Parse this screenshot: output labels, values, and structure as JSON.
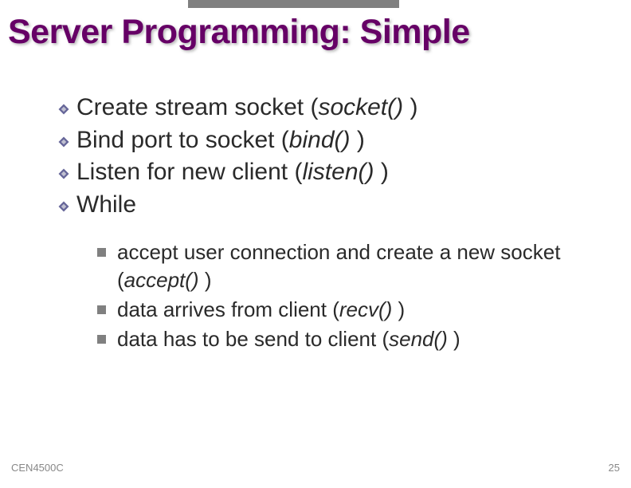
{
  "title": "Server Programming: Simple",
  "bullets": {
    "b1": {
      "pre": "Create stream socket (",
      "fn": "socket()",
      "post": " )"
    },
    "b2": {
      "pre": "Bind port to socket (",
      "fn": "bind()",
      "post": " )"
    },
    "b3": {
      "pre": "Listen for new client (",
      "fn": "listen()",
      "post": " )"
    },
    "b4": {
      "text": "While"
    }
  },
  "subs": {
    "s1": {
      "pre": "accept user connection and create a new socket (",
      "fn": "accept()",
      "post": " )"
    },
    "s2": {
      "pre": "data arrives from client (",
      "fn": "recv()",
      "post": " )"
    },
    "s3": {
      "pre": "data has to be send to client (",
      "fn": "send()",
      "post": " )"
    }
  },
  "footer": {
    "left": "CEN4500C",
    "right": "25"
  },
  "colors": {
    "title": "#660066",
    "bullet_outer": "#666699",
    "bullet_square": "#808080"
  }
}
